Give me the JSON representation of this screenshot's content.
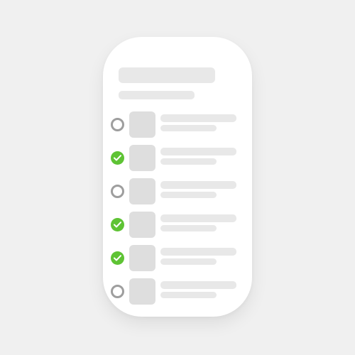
{
  "colors": {
    "background": "#f0f0f0",
    "card": "#ffffff",
    "skeleton": "#e8e8e8",
    "thumbnail": "#dedede",
    "checked": "#5ec334",
    "unchecked_ring": "#9e9e9e"
  },
  "list": {
    "items": [
      {
        "checked": false,
        "icon": "circle-outline-icon"
      },
      {
        "checked": true,
        "icon": "check-circle-icon"
      },
      {
        "checked": false,
        "icon": "circle-outline-icon"
      },
      {
        "checked": true,
        "icon": "check-circle-icon"
      },
      {
        "checked": true,
        "icon": "check-circle-icon"
      },
      {
        "checked": false,
        "icon": "circle-outline-icon"
      }
    ]
  }
}
